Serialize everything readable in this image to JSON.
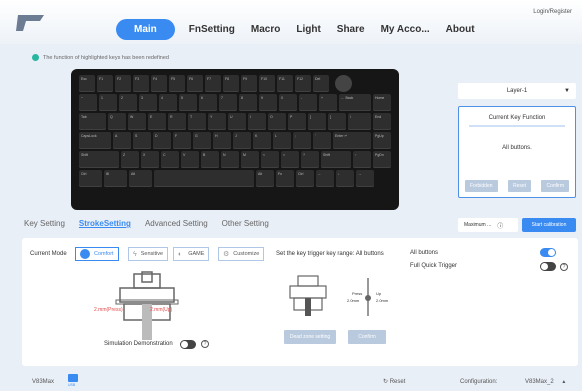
{
  "nav": {
    "items": [
      "Main",
      "FnSetting",
      "Macro",
      "Light",
      "Share",
      "My Acco...",
      "About"
    ],
    "active_index": 0,
    "login": "Login/Register"
  },
  "notice": "The function of highlighted keys has been redefined",
  "keyboard": {
    "rows": [
      [
        "Esc",
        "F1",
        "F2",
        "F3",
        "F4",
        "F5",
        "F6",
        "F7",
        "F8",
        "F9",
        "F10",
        "F11",
        "F12",
        "Del"
      ],
      [
        "~",
        "1",
        "2",
        "3",
        "4",
        "5",
        "6",
        "7",
        "8",
        "9",
        "0",
        "-",
        "+",
        "← Back",
        "Home"
      ],
      [
        "Tab",
        "Q",
        "W",
        "E",
        "R",
        "T",
        "Y",
        "U",
        "I",
        "O",
        "P",
        "[",
        "]",
        "\\",
        "End"
      ],
      [
        "CapsLock",
        "A",
        "S",
        "D",
        "F",
        "G",
        "H",
        "J",
        "K",
        "L",
        ";",
        "'",
        "Enter ↵",
        "PgUp"
      ],
      [
        "Shift",
        "Z",
        "X",
        "C",
        "V",
        "B",
        "N",
        "M",
        "<",
        ">",
        "?",
        "Shift",
        "↑",
        "PgDn"
      ],
      [
        "Ctrl",
        "⊞",
        "Alt",
        "",
        "Alt",
        "Fn",
        "Ctrl",
        "←",
        "↓",
        "→"
      ]
    ]
  },
  "layer_select": "Layer-1",
  "current_key_function": {
    "title": "Current Key Function",
    "body": "All buttons.",
    "buttons": [
      "Forbidden",
      "Reset",
      "Confirm"
    ]
  },
  "subtabs": [
    "Key Setting",
    "StrokeSetting",
    "Advanced Setting",
    "Other Setting"
  ],
  "subtab_active": 1,
  "maximum": "Maximum ...",
  "calibration": "Start calibration",
  "stroke": {
    "current_mode_label": "Current Mode",
    "modes": [
      "Comfort",
      "Sensitive",
      "GAME",
      "Customize"
    ],
    "active_mode": 0,
    "trigger_range_label": "Set the key trigger key range: All buttons",
    "all_buttons_label": "All buttons",
    "all_buttons_on": true,
    "full_quick_trigger_label": "Full Quick Trigger",
    "full_quick_trigger_on": false,
    "travel_text": "2.mm(Press)",
    "travel_text2": "2.mm(Up)",
    "press_label": "Press",
    "press_val": "2.0mm",
    "up_label": "Up",
    "up_val": "2.0mm",
    "simulation_label": "Simulation Demonstration",
    "simulation_on": false,
    "dead_zone_btn": "Dead zone setting",
    "confirm_btn": "Confirm"
  },
  "status": {
    "device": "V83Max",
    "usb_label": "USB",
    "reset": "Reset",
    "configuration": "Configuration:",
    "config_name": "V83Max_2"
  },
  "colors": {
    "accent": "#3a8bf1",
    "teal": "#28b6a0",
    "disabled_btn": "#b9c9de",
    "keyboard_body": "#161616"
  }
}
